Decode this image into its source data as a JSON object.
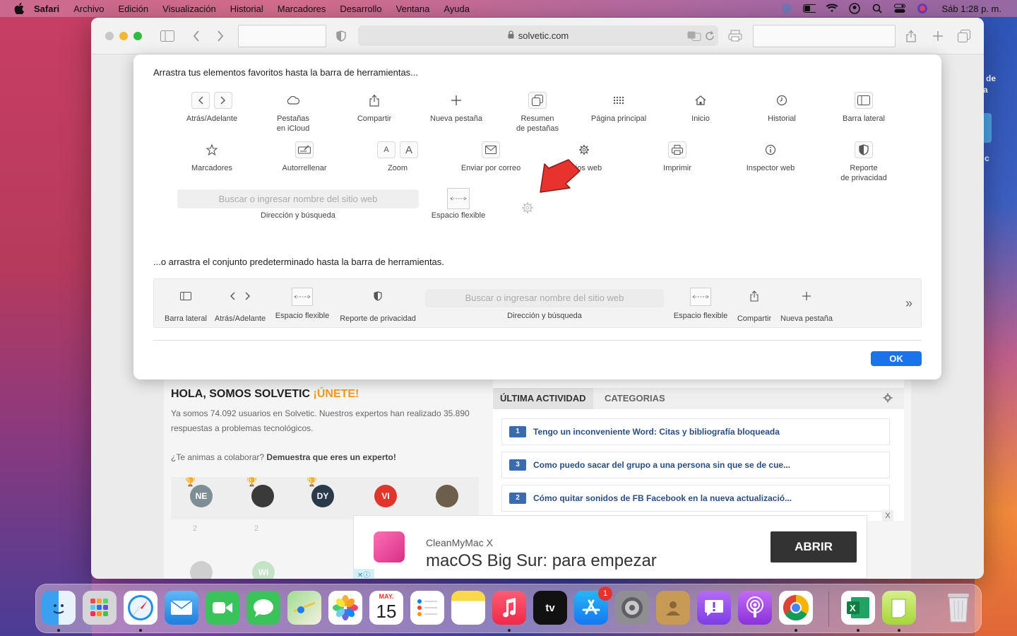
{
  "menubar": {
    "app": "Safari",
    "items": [
      "Archivo",
      "Edición",
      "Visualización",
      "Historial",
      "Marcadores",
      "Desarrollo",
      "Ventana",
      "Ayuda"
    ],
    "clock": "Sáb 1:28 p. m."
  },
  "desktop": {
    "label1": "de",
    "label2": "a",
    "label3": "c"
  },
  "browser": {
    "url": "solvetic.com"
  },
  "customize": {
    "title": "Arrastra tus elementos favoritos hasta la barra de herramientas...",
    "items_row1": [
      {
        "label": "Atrás/Adelante",
        "icon": "back-forward-icon"
      },
      {
        "label": "Pestañas\nen iCloud",
        "icon": "cloud-icon"
      },
      {
        "label": "Compartir",
        "icon": "share-icon"
      },
      {
        "label": "Nueva pestaña",
        "icon": "plus-icon"
      },
      {
        "label": "Resumen\nde pestañas",
        "icon": "tab-overview-icon"
      },
      {
        "label": "Página principal",
        "icon": "grid-icon"
      },
      {
        "label": "Inicio",
        "icon": "home-icon"
      },
      {
        "label": "Historial",
        "icon": "clock-icon"
      },
      {
        "label": "Barra lateral",
        "icon": "sidebar-icon"
      }
    ],
    "items_row2": [
      {
        "label": "Marcadores",
        "icon": "star-icon"
      },
      {
        "label": "Autorrellenar",
        "icon": "autofill-icon"
      },
      {
        "label": "Zoom",
        "icon": "zoom-icon",
        "glyph": "A"
      },
      {
        "label": "Enviar por correo",
        "icon": "mail-icon"
      },
      {
        "label": "Sitios web",
        "icon": "gear-icon"
      },
      {
        "label": "Imprimir",
        "icon": "print-icon"
      },
      {
        "label": "Inspector web",
        "icon": "info-icon"
      },
      {
        "label": "Reporte\nde privacidad",
        "icon": "shield-icon"
      }
    ],
    "search_placeholder": "Buscar o ingresar nombre del sitio web",
    "search_label": "Dirección y búsqueda",
    "flex_label": "Espacio flexible",
    "default_title": "...o arrastra el conjunto predeterminado hasta la barra de herramientas.",
    "default_set": {
      "sidebar": "Barra lateral",
      "back_forward": "Atrás/Adelante",
      "flex1": "Espacio flexible",
      "privacy": "Reporte de privacidad",
      "search_placeholder": "Buscar o ingresar nombre del sitio web",
      "search": "Dirección y búsqueda",
      "flex2": "Espacio flexible",
      "share": "Compartir",
      "new_tab": "Nueva pestaña"
    },
    "ok": "OK"
  },
  "webpage": {
    "title_main": "HOLA, SOMOS SOLVETIC",
    "title_cta": "¡ÚNETE!",
    "intro": "Ya somos 74.092 usuarios en Solvetic. Nuestros expertos han realizado 35.890 respuestas a problemas tecnológicos.",
    "collab_q": "¿Te animas a colaborar?",
    "collab_cta": "Demuestra que eres un experto!",
    "avatars": [
      {
        "initials": "NE",
        "color": "#7d8e95"
      },
      {
        "initials": "",
        "color": "#3a3a3a"
      },
      {
        "initials": "DY",
        "color": "#2b3a4a"
      },
      {
        "initials": "VI",
        "color": "#e0352b"
      },
      {
        "initials": "",
        "color": "#6e5e4c"
      }
    ],
    "avatar_counts": [
      "2",
      "2"
    ],
    "avatars_row2": [
      {
        "initials": "",
        "color": "#b5b5b5"
      },
      {
        "initials": "WI",
        "color": "#a5d9a6"
      }
    ],
    "tabs": [
      "ÚLTIMA ACTIVIDAD",
      "CATEGORIAS"
    ],
    "activity": [
      {
        "num": "1",
        "text": "Tengo un inconveniente Word: Citas y bibliografía bloqueada"
      },
      {
        "num": "3",
        "text": "Como puedo sacar del grupo a una persona sin que se de cue..."
      },
      {
        "num": "2",
        "text": "Cómo quitar sonidos de FB Facebook en la nueva actualizació..."
      }
    ],
    "ad": {
      "sub": "CleanMyMac X",
      "main": "macOS Big Sur: para empezar",
      "button": "ABRIR",
      "close": "X"
    }
  },
  "dock": {
    "calendar_month": "MAY.",
    "calendar_day": "15",
    "appstore_badge": "1",
    "apps": [
      "finder-icon",
      "launchpad-icon",
      "safari-icon",
      "mail-icon",
      "facetime-icon",
      "messages-icon",
      "maps-icon",
      "photos-icon",
      "calendar-icon",
      "reminders-icon",
      "notes-icon",
      "music-icon",
      "tv-icon",
      "appstore-icon",
      "settings-icon",
      "contacts-icon",
      "feedback-icon",
      "podcasts-icon",
      "chrome-icon",
      "excel-icon",
      "numbers-icon",
      "trash-icon"
    ]
  },
  "colors": {
    "accent": "#1a73e8",
    "solvetic_orange": "#f39a1f",
    "link_blue": "#2a4e80",
    "arrow_red": "#e8322e"
  }
}
